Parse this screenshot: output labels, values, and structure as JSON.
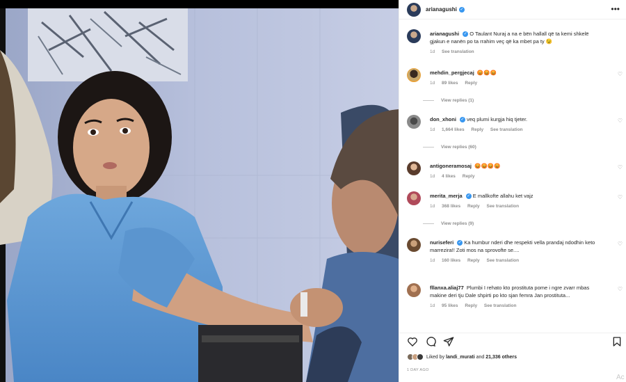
{
  "post": {
    "username": "arianagushi",
    "caption": "O Taulant Nuraj a na e bën hallall që ta kemi shkelë gjakun e nanën po ta rrahim veç që ka mbet pa ty 😉",
    "caption_time": "1d",
    "caption_translate": "See translation",
    "more": "•••"
  },
  "comments": [
    {
      "user": "mehdin_pergjecaj",
      "text": "😡😡😡",
      "time": "1d",
      "likes": "89 likes",
      "reply": "Reply",
      "translate": "",
      "view_replies": "View replies (1)",
      "verified": false
    },
    {
      "user": "don_xhoni",
      "text": "veq plumi kurgja hiq tjeter.",
      "time": "1d",
      "likes": "1,664 likes",
      "reply": "Reply",
      "translate": "See translation",
      "view_replies": "View replies (60)",
      "verified": true
    },
    {
      "user": "antigoneramosaj",
      "text": "😡😡😡😡",
      "time": "1d",
      "likes": "4 likes",
      "reply": "Reply",
      "translate": "",
      "view_replies": "",
      "verified": false
    },
    {
      "user": "merita_merja",
      "text": "E mallkofte allahu ket vajz",
      "time": "1d",
      "likes": "368 likes",
      "reply": "Reply",
      "translate": "See translation",
      "view_replies": "View replies (9)",
      "verified": true
    },
    {
      "user": "nuriseferi",
      "text": "Ka humbur nderi dhe respekti vella prandaj ndodhin keto marrezira!! Zoti mos na sprovofte se....",
      "time": "1d",
      "likes": "160 likes",
      "reply": "Reply",
      "translate": "See translation",
      "view_replies": "",
      "verified": true
    },
    {
      "user": "fllanxa.aliaj77",
      "text": "Plumbi I rehato kto prostituta pome i ngre zvarr mbas makine deri tju Dale shpirti po kto sjan femra Jan prostituta...",
      "time": "1d",
      "likes": "95 likes",
      "reply": "Reply",
      "translate": "See translation",
      "view_replies": "",
      "verified": false
    }
  ],
  "likes_summary": {
    "prefix": "Liked by",
    "user": "landi_murati",
    "mid": "and",
    "count": "21,336 others"
  },
  "date": "1 DAY AGO",
  "watermark": "Ac"
}
